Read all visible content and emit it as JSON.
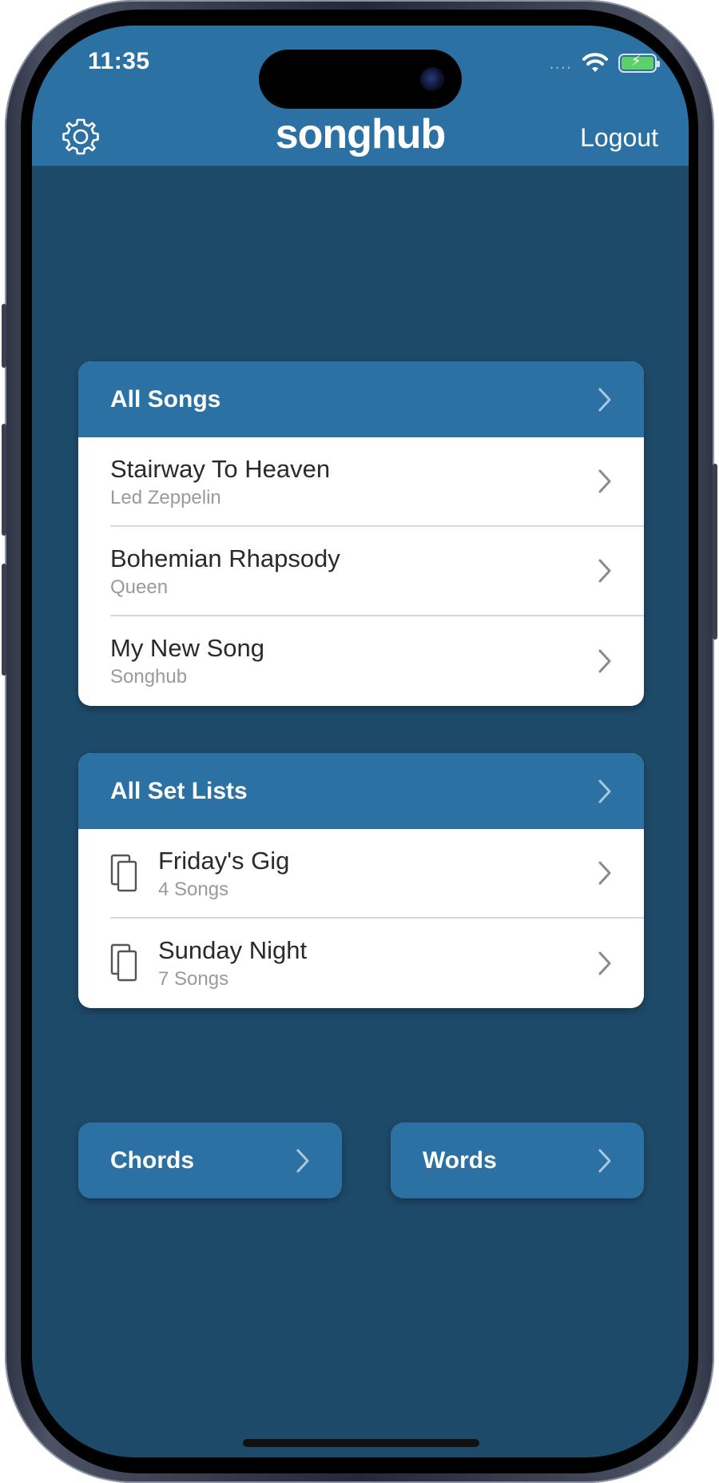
{
  "status_bar": {
    "time": "11:35",
    "signal": "....",
    "battery_color": "#5ed06a"
  },
  "header": {
    "logo": "songhub",
    "logout_label": "Logout",
    "settings_icon": "gear-icon"
  },
  "songs_card": {
    "title": "All Songs",
    "items": [
      {
        "title": "Stairway To Heaven",
        "subtitle": "Led Zeppelin"
      },
      {
        "title": "Bohemian Rhapsody",
        "subtitle": "Queen"
      },
      {
        "title": "My New Song",
        "subtitle": "Songhub"
      }
    ]
  },
  "setlists_card": {
    "title": "All Set Lists",
    "items": [
      {
        "title": "Friday's Gig",
        "subtitle": "4 Songs",
        "icon": "document-stack-icon"
      },
      {
        "title": "Sunday Night",
        "subtitle": "7 Songs",
        "icon": "document-stack-icon"
      }
    ]
  },
  "buttons": {
    "chords_label": "Chords",
    "words_label": "Words"
  },
  "colors": {
    "background": "#1e4a69",
    "accent": "#2c71a3",
    "card": "#ffffff"
  }
}
